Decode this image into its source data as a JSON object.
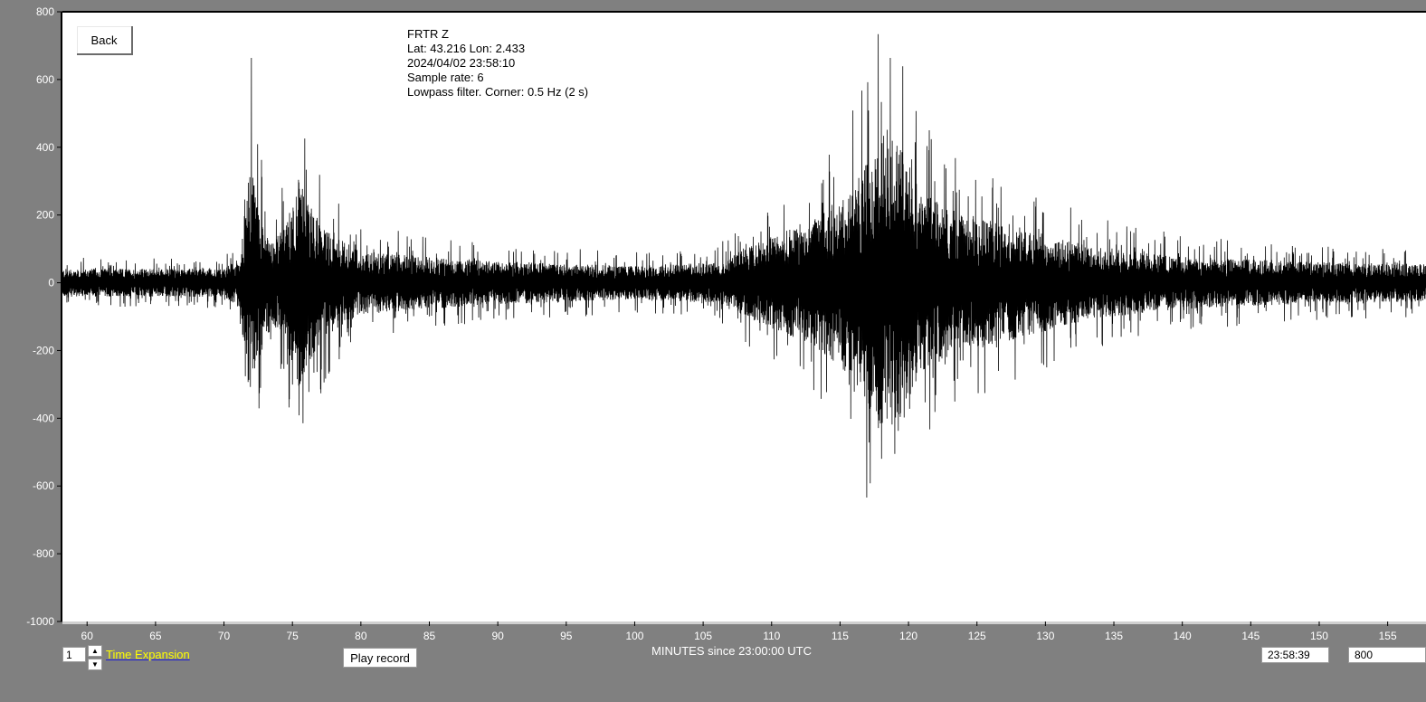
{
  "chart_data": {
    "type": "line",
    "title_lines": [
      "FRTR  Z",
      "Lat: 43.216 Lon: 2.433",
      "2024/04/02 23:58:10",
      "Sample rate: 6",
      "Lowpass filter. Corner: 0.5 Hz (2 s)"
    ],
    "xlabel": "MINUTES since 23:00:00 UTC",
    "ylabel": "",
    "xlim": [
      58.2,
      157.8
    ],
    "ylim": [
      -1000,
      800
    ],
    "x_ticks": [
      60,
      65,
      70,
      75,
      80,
      85,
      90,
      95,
      100,
      105,
      110,
      115,
      120,
      125,
      130,
      135,
      140,
      145,
      150,
      155
    ],
    "y_ticks": [
      800,
      600,
      400,
      200,
      0,
      -200,
      -400,
      -600,
      -800,
      -1000
    ],
    "series": [
      {
        "color": "#000000",
        "envelope": [
          {
            "x": 58.2,
            "amp": 75
          },
          {
            "x": 70.0,
            "amp": 75
          },
          {
            "x": 71.2,
            "amp": 140
          },
          {
            "x": 71.6,
            "amp": 450
          },
          {
            "x": 72.0,
            "amp": 670
          },
          {
            "x": 72.5,
            "amp": 420
          },
          {
            "x": 73.5,
            "amp": 230
          },
          {
            "x": 74.5,
            "amp": 300
          },
          {
            "x": 75.4,
            "amp": 570
          },
          {
            "x": 76.2,
            "amp": 430
          },
          {
            "x": 77.5,
            "amp": 280
          },
          {
            "x": 80.0,
            "amp": 170
          },
          {
            "x": 85.0,
            "amp": 140
          },
          {
            "x": 90.0,
            "amp": 115
          },
          {
            "x": 100.0,
            "amp": 90
          },
          {
            "x": 106.0,
            "amp": 110
          },
          {
            "x": 110.0,
            "amp": 250
          },
          {
            "x": 113.0,
            "amp": 330
          },
          {
            "x": 116.0,
            "amp": 520
          },
          {
            "x": 118.2,
            "amp": 800
          },
          {
            "x": 119.3,
            "amp": 740
          },
          {
            "x": 121.0,
            "amp": 480
          },
          {
            "x": 124.0,
            "amp": 360
          },
          {
            "x": 128.0,
            "amp": 300
          },
          {
            "x": 133.0,
            "amp": 200
          },
          {
            "x": 140.0,
            "amp": 140
          },
          {
            "x": 150.0,
            "amp": 110
          },
          {
            "x": 157.8,
            "amp": 100
          }
        ]
      }
    ],
    "grid": false
  },
  "controls": {
    "back_label": "Back",
    "expansion_value": "1",
    "expansion_label": "Time Expansion",
    "play_label": "Play record",
    "time_value": "23:58:39",
    "amplitude_value": "800"
  },
  "colors": {
    "background": "#808080",
    "plot_background": "#ffffff",
    "trace": "#000000",
    "axis_text": "#ffffff",
    "expansion_label": "#ffff00"
  }
}
